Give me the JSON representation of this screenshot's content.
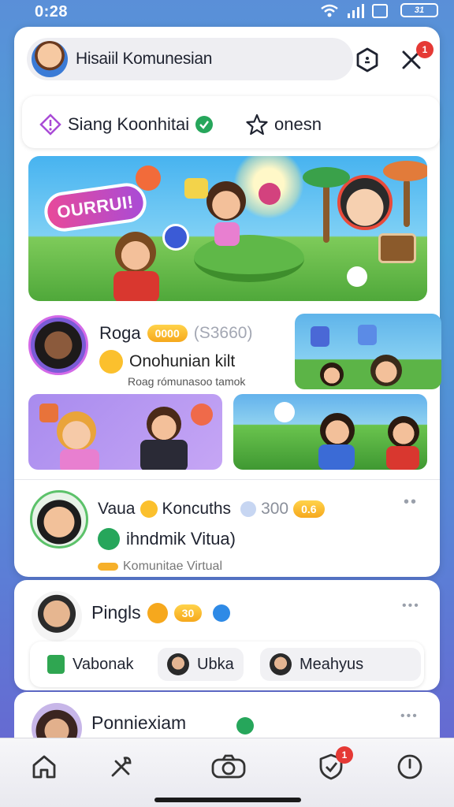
{
  "status_bar": {
    "time": "0:28",
    "battery": "31"
  },
  "header": {
    "title": "Hisaiil Komunesian",
    "notification_count": "1"
  },
  "tabs": [
    {
      "label": "Siang Koonhitai"
    },
    {
      "label": "onesn"
    }
  ],
  "banner": {
    "sign_text": "OURRUI!"
  },
  "post1": {
    "name": "Roga",
    "points_badge": "0000",
    "count_text": "(S3660)",
    "subtitle": "Onohunian kilt",
    "caption": "Roag rómunasoo tamok"
  },
  "post2": {
    "name": "Vaua",
    "title_rest": "Koncuths",
    "count": "300",
    "badge": "0.6",
    "subtitle": "ihndmik Vitua)",
    "tag": "Komunitae Virtual"
  },
  "card2": {
    "name": "Pingls",
    "badge": "30",
    "chips": [
      {
        "label": "Vabonak"
      },
      {
        "label": "Ubka"
      },
      {
        "label": "Meahyus"
      }
    ]
  },
  "card3": {
    "name": "Ponniexiam"
  },
  "bottom_nav": {
    "badge_count": "1",
    "items": [
      "home-icon",
      "tools-icon",
      "camera-icon",
      "shield-icon",
      "clock-icon"
    ]
  },
  "colors": {
    "accent_purple": "#a94bd6",
    "verified_green": "#26a65b",
    "badge_red": "#e53935",
    "gold": "#f6a81d"
  }
}
